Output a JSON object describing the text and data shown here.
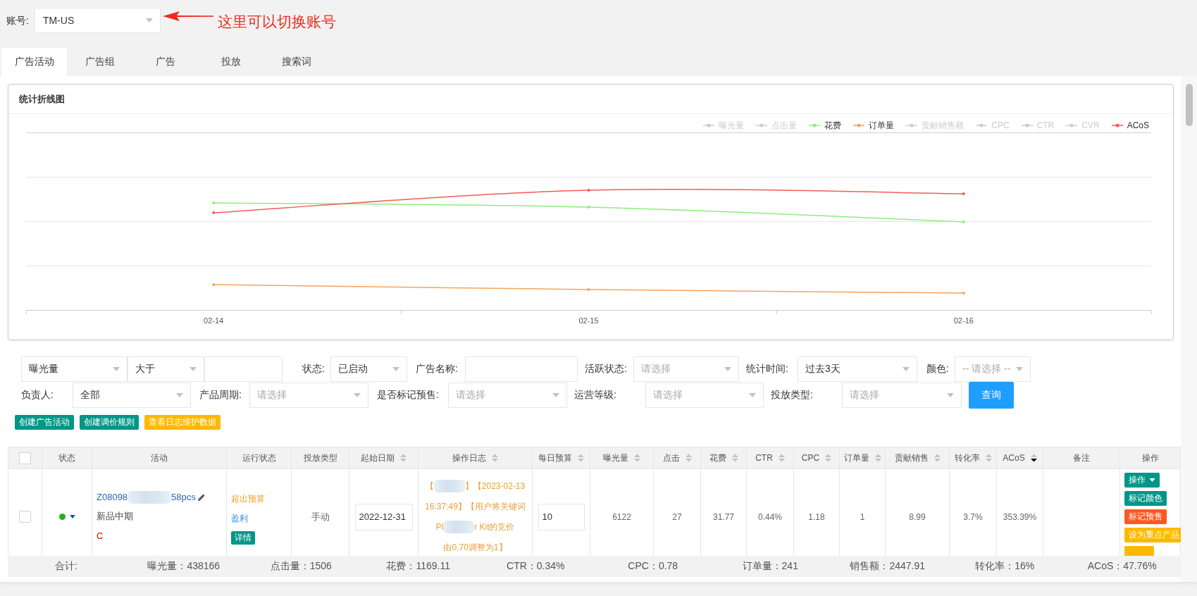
{
  "account": {
    "label": "账号:",
    "value": "TM-US"
  },
  "annotation": {
    "text": "这里可以切换账号"
  },
  "tabs": [
    {
      "label": "广告活动",
      "selected": true
    },
    {
      "label": "广告组",
      "selected": false
    },
    {
      "label": "广告",
      "selected": false
    },
    {
      "label": "投放",
      "selected": false
    },
    {
      "label": "搜索词",
      "selected": false
    }
  ],
  "chart_panel": {
    "title": "统计折线图",
    "legend": [
      {
        "label": "曝光量",
        "selected": false
      },
      {
        "label": "点击量",
        "selected": false
      },
      {
        "label": "花费",
        "selected": true,
        "color": "#90ed7d"
      },
      {
        "label": "订单量",
        "selected": true,
        "color": "#f7a35c"
      },
      {
        "label": "贡献销售额",
        "selected": false
      },
      {
        "label": "CPC",
        "selected": false
      },
      {
        "label": "CTR",
        "selected": false
      },
      {
        "label": "CVR",
        "selected": false
      },
      {
        "label": "ACoS",
        "selected": true,
        "color": "#f45b5b"
      }
    ],
    "x_labels": [
      "02-14",
      "02-15",
      "02-16"
    ]
  },
  "filters": [
    [
      {
        "kind": "select",
        "value": "曝光量"
      },
      {
        "kind": "select",
        "value": "大于"
      },
      {
        "kind": "input"
      },
      {
        "kind": "select",
        "label": "状态:",
        "value": "已启动"
      },
      {
        "kind": "input",
        "label": "广告名称:"
      },
      {
        "kind": "select",
        "label": "活跃状态:",
        "placeholder": "请选择"
      },
      {
        "kind": "select",
        "label": "统计时间:",
        "value": "过去3天"
      },
      {
        "kind": "select",
        "label": "颜色:",
        "placeholder": "-- 请选择 --"
      }
    ],
    [
      {
        "kind": "select",
        "label": "负责人:",
        "value": "全部"
      },
      {
        "kind": "select",
        "label": "产品周期:",
        "placeholder": "请选择"
      },
      {
        "kind": "select",
        "label": "是否标记预售:",
        "placeholder": "请选择"
      },
      {
        "kind": "select",
        "label": "运营等级:",
        "placeholder": "请选择"
      },
      {
        "kind": "select",
        "label": "投放类型:",
        "placeholder": "请选择"
      },
      {
        "kind": "button",
        "label": "查询"
      }
    ]
  ],
  "action_buttons": [
    {
      "label": "创建广告活动",
      "color": "#009688"
    },
    {
      "label": "创建调价规则",
      "color": "#009688"
    },
    {
      "label": "查看日志维护数据",
      "color": "#ffb800"
    }
  ],
  "table": {
    "select_all": {
      "checked": false
    },
    "columns": [
      {
        "label": "状态"
      },
      {
        "label": "活动"
      },
      {
        "label": "运行状态"
      },
      {
        "label": "投放类型"
      },
      {
        "label": "起始日期",
        "sorted": false
      },
      {
        "label": "操作日志",
        "sorted": false
      },
      {
        "label": "每日预算",
        "sorted": false
      },
      {
        "label": "曝光量",
        "sorted": false
      },
      {
        "label": "点击",
        "sorted": false
      },
      {
        "label": "花费",
        "sorted": false
      },
      {
        "label": "CTR",
        "sorted": false
      },
      {
        "label": "CPC",
        "sorted": false
      },
      {
        "label": "订单量",
        "sorted": false
      },
      {
        "label": "贡献销售",
        "sorted": false
      },
      {
        "label": "转化率",
        "sorted": false
      },
      {
        "label": "ACoS",
        "sorted": true
      },
      {
        "label": "备注"
      },
      {
        "label": "操作"
      }
    ],
    "rows": [
      {
        "checked": false,
        "status": {
          "color": "#22b022"
        },
        "campaign": {
          "name": [
            {
              "kind": "text",
              "text": "Z08098"
            },
            {
              "kind": "blur"
            },
            {
              "kind": "text",
              "text": "58pcs"
            }
          ],
          "stage": "新品中期",
          "grade": "C"
        },
        "run_status": [
          {
            "kind": "warning",
            "text": "超出预算"
          },
          {
            "kind": "profit",
            "text": "盈利"
          },
          {
            "kind": "button",
            "text": "详情"
          }
        ],
        "targeting": "手动",
        "start_date": "2022-12-31",
        "log_lines": [
          [
            {
              "kind": "text",
              "text": "【"
            },
            {
              "kind": "blur"
            },
            {
              "kind": "text",
              "text": "】【2023-02-13"
            }
          ],
          [
            {
              "kind": "text",
              "text": "16:37:49】【用户将关键词"
            }
          ],
          [
            {
              "kind": "text",
              "text": "Pl"
            },
            {
              "kind": "blur"
            },
            {
              "kind": "text",
              "text": "r Kit的竞价"
            }
          ],
          [
            {
              "kind": "text",
              "text": "由0.70调整为1】"
            }
          ]
        ],
        "daily_budget": "10",
        "metrics": [
          "6122",
          "27",
          "31.77",
          "0.44%",
          "1.18",
          "1",
          "8.99",
          "3.7%",
          "353.39%"
        ],
        "actions": [
          {
            "kind": "dropdown",
            "label": "操作",
            "color": "#009688"
          },
          {
            "kind": "button",
            "label": "标记颜色",
            "color": "#009688"
          },
          {
            "kind": "button",
            "label": "标记预售",
            "color": "#ff5722"
          },
          {
            "kind": "button",
            "label": "设为重点产品",
            "color": "#ffb800"
          },
          {
            "kind": "button",
            "color": "#ffb800"
          }
        ]
      }
    ]
  },
  "summary": [
    "合计:",
    "曝光量：438166",
    "点击量：1506",
    "花费：1169.11",
    "CTR：0.34%",
    "CPC：0.78",
    "订单量：241",
    "销售额：2447.91",
    "转化率：16%",
    "ACoS：47.76%"
  ]
}
